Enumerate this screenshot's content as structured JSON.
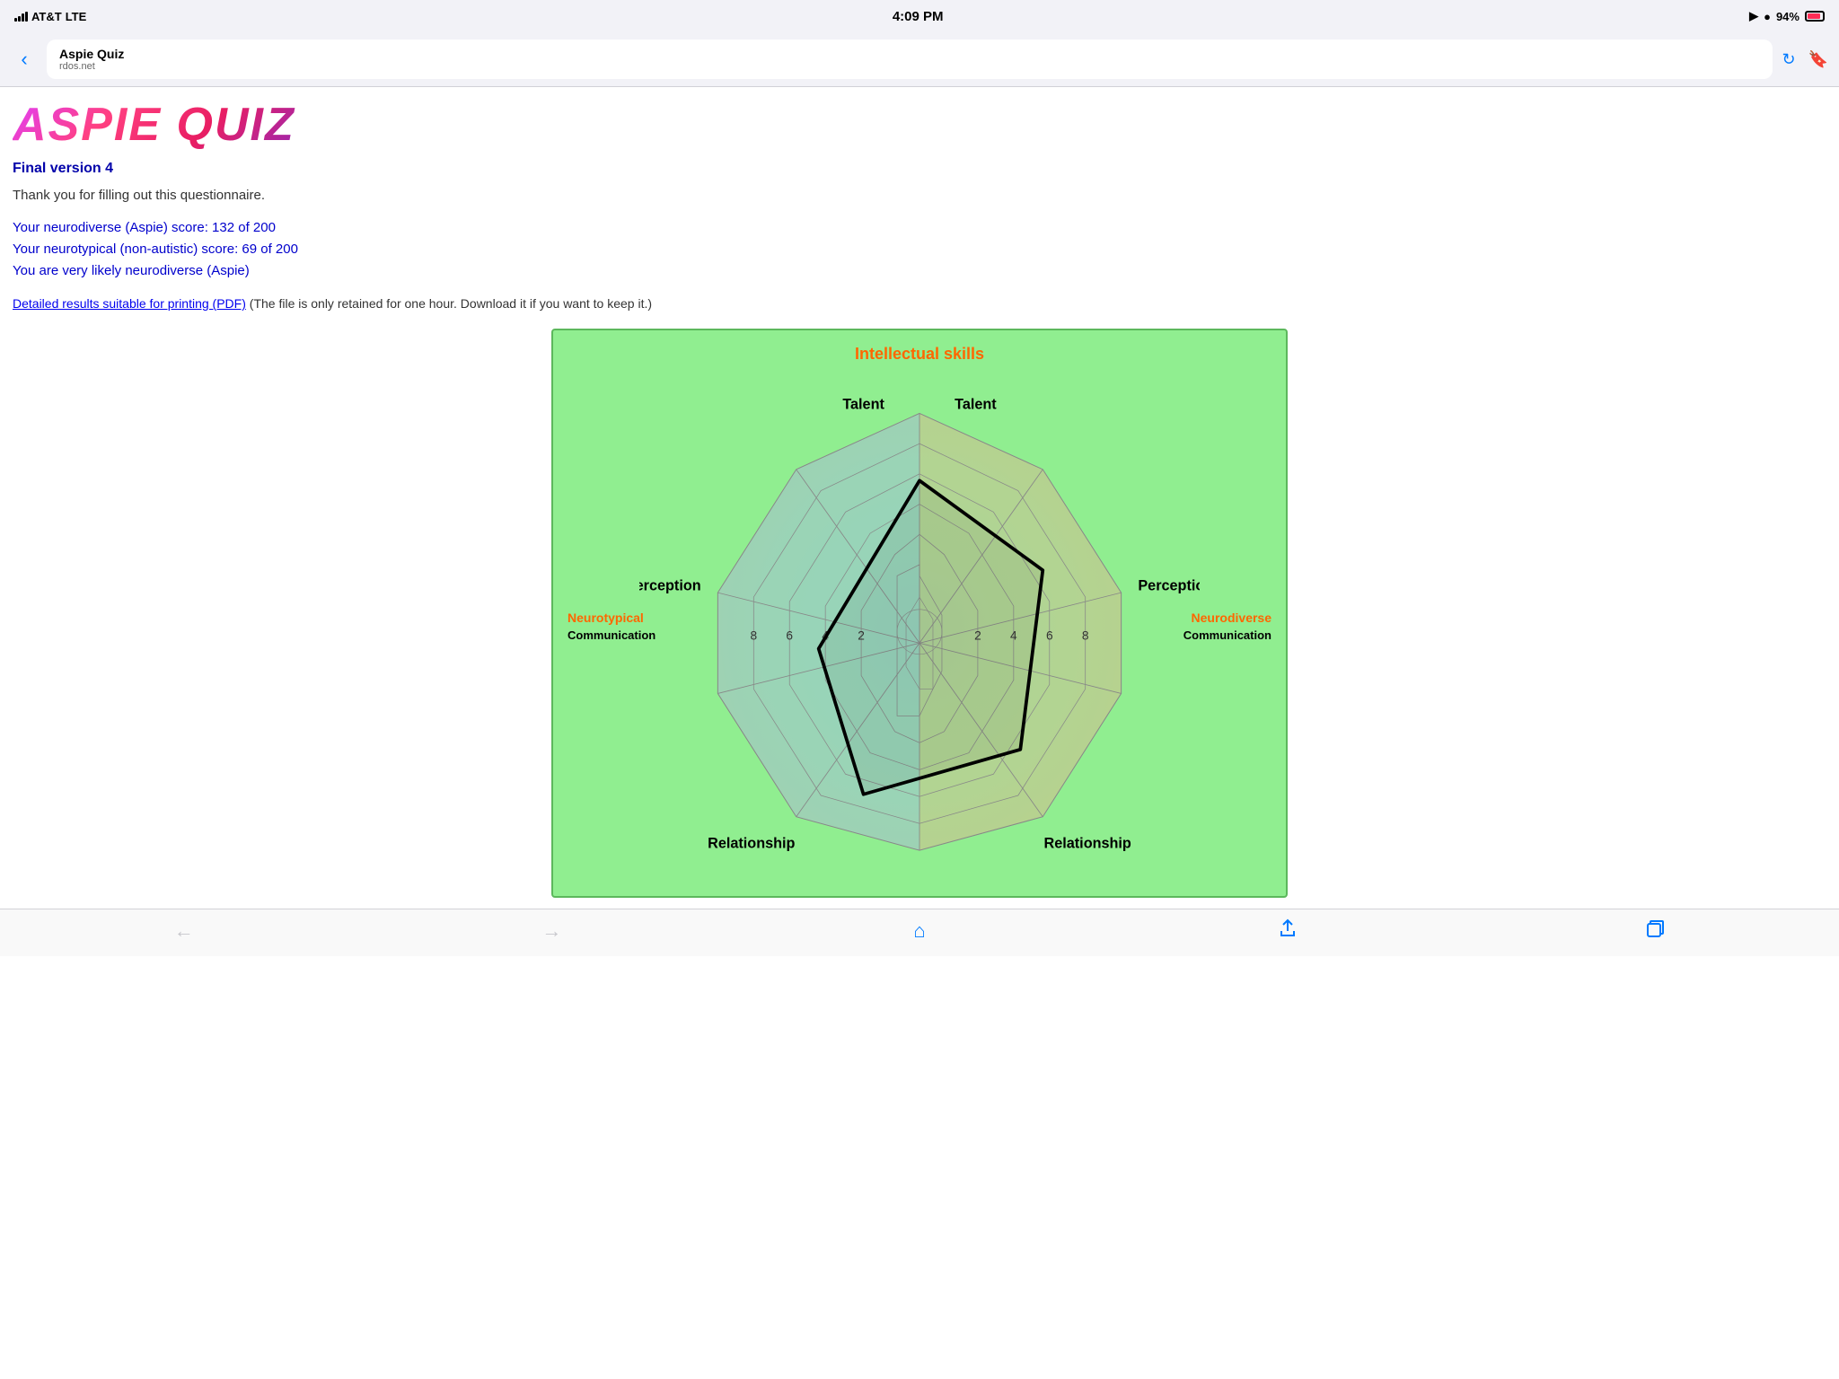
{
  "statusBar": {
    "carrier": "AT&T",
    "networkType": "LTE",
    "time": "4:09 PM",
    "battery": "94%",
    "locationActive": true
  },
  "browser": {
    "siteTitle": "Aspie Quiz",
    "siteUrl": "rdos.net",
    "backEnabled": true,
    "forwardEnabled": false
  },
  "page": {
    "logoText": "ASPIE QUIZ",
    "versionLabel": "Final version 4",
    "thankYouText": "Thank you for filling out this questionnaire.",
    "scores": {
      "neurodiverse": "Your neurodiverse (Aspie) score: 132 of 200",
      "neurotypical": "Your neurotypical (non-autistic) score: 69 of 200",
      "verdict": "You are very likely neurodiverse (Aspie)"
    },
    "pdfLinkText": "Detailed results suitable for printing (PDF)",
    "pdfNote": "(The file is only retained for one hour. Download it if you want to keep it.)",
    "chart": {
      "title": "Intellectual skills",
      "leftLabel": "Neurotypical",
      "rightLabel": "Neurodiverse",
      "topLeft": "Talent",
      "topRight": "Talent",
      "midLeft": "Perception",
      "midRight": "Perception",
      "bottomLeft": "Communication",
      "bottomRight": "Communication",
      "bottomFarLeft": "Relationship",
      "bottomFarRight": "Relationship",
      "axisNumbers": [
        "8",
        "6",
        "4",
        "2",
        "2",
        "4",
        "6",
        "8"
      ]
    }
  },
  "bottomNav": {
    "back": "←",
    "forward": "→",
    "home": "⌂",
    "share": "↑",
    "tabs": "⧉"
  }
}
